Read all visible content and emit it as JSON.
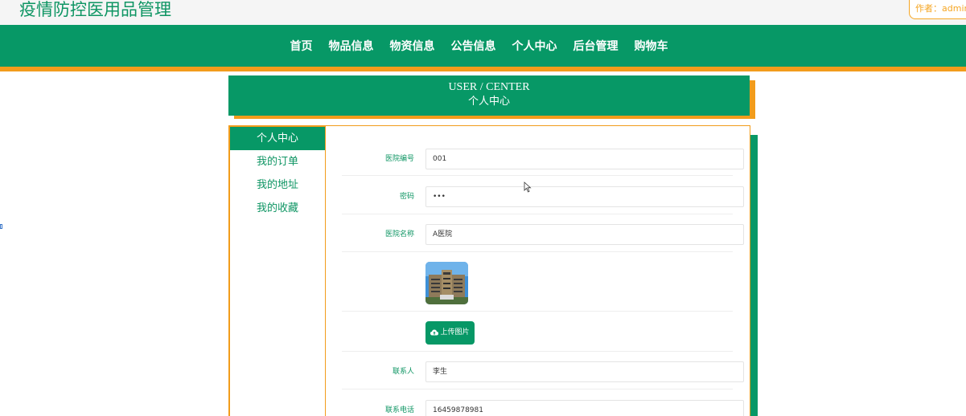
{
  "header": {
    "site_title": "疫情防控医用品管理",
    "author_label": "作者：",
    "author_name": "admin"
  },
  "nav": {
    "items": [
      "首页",
      "物品信息",
      "物资信息",
      "公告信息",
      "个人中心",
      "后台管理",
      "购物车"
    ]
  },
  "banner": {
    "title_en": "USER / CENTER",
    "title_cn": "个人中心"
  },
  "sidebar": {
    "items": [
      "个人中心",
      "我的订单",
      "我的地址",
      "我的收藏"
    ],
    "active_index": 0
  },
  "form": {
    "hospital_id_label": "医院编号",
    "hospital_id_value": "001",
    "password_label": "密码",
    "password_value": "•••",
    "hospital_name_label": "医院名称",
    "hospital_name_value": "A医院",
    "upload_label": "上传图片",
    "contact_label": "联系人",
    "contact_value": "李生",
    "phone_label": "联系电话",
    "phone_value": "16459878981"
  },
  "colors": {
    "primary_green": "#079866",
    "accent_orange": "#f29c1b",
    "text_green": "#0e9563"
  }
}
